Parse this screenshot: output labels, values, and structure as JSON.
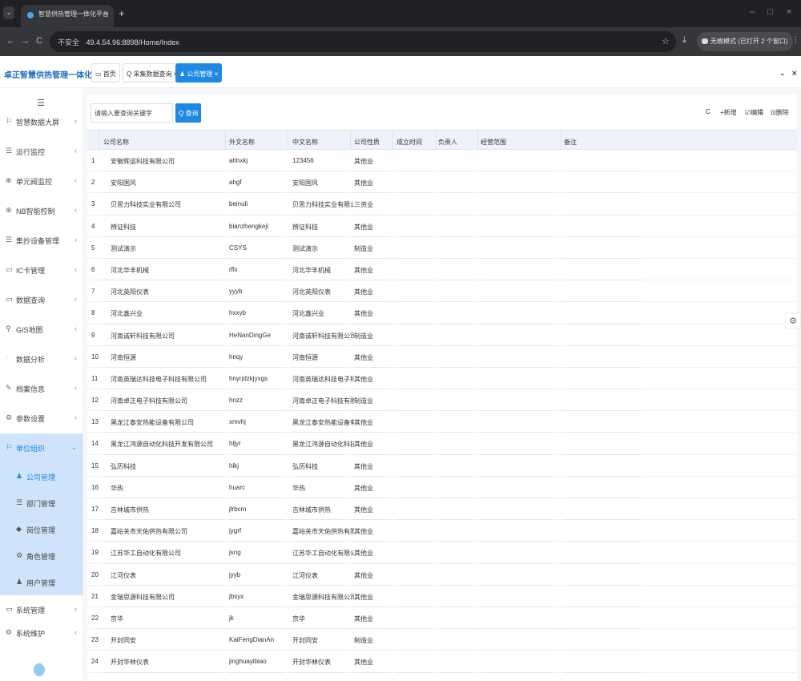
{
  "browser": {
    "tab_title": "智慧供热管理一体化平台",
    "tab_close": "×",
    "new_tab": "+",
    "min": "–",
    "restore": "□",
    "close": "×",
    "back": "←",
    "forward": "→",
    "reload": "C",
    "insecure": "不安全",
    "url": "49.4.54.96:8898/Home/Index",
    "star": "☆",
    "download": "⤓",
    "incognito_text": "无痕模式 (已打开 2 个窗口)",
    "menu": "⋮"
  },
  "app": {
    "brand": "卓正智慧供热管理一体化平台",
    "tabs": [
      {
        "icon": "▭",
        "label": "首页"
      },
      {
        "icon": "Q",
        "label": "采集数据查询",
        "close": "×"
      },
      {
        "icon": "♟",
        "label": "公司管理",
        "close": "×"
      }
    ],
    "header_right_down": "⌄",
    "header_right_x": "⨯"
  },
  "sidebar": {
    "collapse_icon": "☰",
    "items": [
      {
        "icon": "⚐",
        "label": "智慧数据大屏",
        "arrow": "‹"
      },
      {
        "icon": "☰",
        "label": "运行监控",
        "arrow": "‹"
      },
      {
        "icon": "⊕",
        "label": "单元阀监控",
        "arrow": "‹"
      },
      {
        "icon": "⊕",
        "label": "NB智能控制",
        "arrow": "‹"
      },
      {
        "icon": "☰",
        "label": "集抄设备管理",
        "arrow": "‹"
      },
      {
        "icon": "▭",
        "label": "IC卡管理",
        "arrow": "‹"
      },
      {
        "icon": "▭",
        "label": "数据查询",
        "arrow": "‹"
      },
      {
        "icon": "⚲",
        "label": "GIS地图",
        "arrow": "‹"
      },
      {
        "icon": "⫶",
        "label": "数据分析",
        "arrow": "‹"
      },
      {
        "icon": "✎",
        "label": "档案信息",
        "arrow": "‹"
      },
      {
        "icon": "⚙",
        "label": "参数设置",
        "arrow": "‹"
      },
      {
        "icon": "⚐",
        "label": "单位组织",
        "arrow": "⌄"
      }
    ],
    "subitems": [
      {
        "icon": "♟",
        "label": "公司管理"
      },
      {
        "icon": "☰",
        "label": "部门管理"
      },
      {
        "icon": "◆",
        "label": "岗位管理"
      },
      {
        "icon": "⚙",
        "label": "角色管理"
      },
      {
        "icon": "♟",
        "label": "用户管理"
      }
    ],
    "bottom_items": [
      {
        "icon": "▭",
        "label": "系统管理",
        "arrow": "‹"
      },
      {
        "icon": "⚙",
        "label": "系统维护",
        "arrow": "‹"
      }
    ]
  },
  "toolbar": {
    "search_placeholder": "请输入要查询关键字",
    "search_button": "查询",
    "search_icon": "Q",
    "refresh": "C",
    "add": "+新增",
    "edit": "☑编辑",
    "delete": "⊡删除"
  },
  "table": {
    "headers": [
      "公司名称",
      "外文名称",
      "中文名称",
      "公司性质",
      "成立时间",
      "负责人",
      "经营范围",
      "备注"
    ],
    "rows": [
      {
        "n": "1",
        "name": "安徽辉运科技有限公司",
        "en": "ahhxkj",
        "cn": "123456",
        "type": "其他业"
      },
      {
        "n": "2",
        "name": "安阳国风",
        "en": "ahgf",
        "cn": "安阳国风",
        "type": "其他业"
      },
      {
        "n": "3",
        "name": "贝思力科技实业有限公司",
        "en": "beinuli",
        "cn": "贝思力科技实业有限公司",
        "type": "三资业"
      },
      {
        "n": "4",
        "name": "辨证科技",
        "en": "bianzhengkeji",
        "cn": "辨证科技",
        "type": "其他业"
      },
      {
        "n": "5",
        "name": "测试演示",
        "en": "CSYS",
        "cn": "测试演示",
        "type": "制造业"
      },
      {
        "n": "6",
        "name": "河北华丰机械",
        "en": "rflx",
        "cn": "河北华丰机械",
        "type": "其他业"
      },
      {
        "n": "7",
        "name": "河北英阳仪表",
        "en": "yyyb",
        "cn": "河北英阳仪表",
        "type": "其他业"
      },
      {
        "n": "8",
        "name": "河北鑫兴业",
        "en": "hxxyb",
        "cn": "河北鑫兴业",
        "type": "其他业"
      },
      {
        "n": "9",
        "name": "河南诚轩科技有限公司",
        "en": "HeNanDingGe",
        "cn": "河南诚轩科技有限公司",
        "type": "制造业"
      },
      {
        "n": "10",
        "name": "河南恒源",
        "en": "hnqy",
        "cn": "河南恒源",
        "type": "其他业"
      },
      {
        "n": "11",
        "name": "河南英瑞达科技电子科技有限公司",
        "en": "hnyrjdzkjyxgs",
        "cn": "河南英瑞达科技电子科技有...",
        "type": "其他业"
      },
      {
        "n": "12",
        "name": "河南卓正电子科技有限公司",
        "en": "hnzz",
        "cn": "河南卓正电子科技有限公司",
        "type": "制造业"
      },
      {
        "n": "13",
        "name": "黑龙江泰安热能设备有限公司",
        "en": "xmvhj",
        "cn": "黑龙江泰安热能设备有限公司",
        "type": "其他业"
      },
      {
        "n": "14",
        "name": "黑龙江鸿源自动化科技开发有限公司",
        "en": "hljyr",
        "cn": "黑龙江鸿源自动化科技开...",
        "type": "其他业"
      },
      {
        "n": "15",
        "name": "弘历科技",
        "en": "hlkj",
        "cn": "弘历科技",
        "type": "其他业"
      },
      {
        "n": "16",
        "name": "华热",
        "en": "huarc",
        "cn": "华热",
        "type": "其他业"
      },
      {
        "n": "17",
        "name": "吉林城市供热",
        "en": "jlrbcm",
        "cn": "吉林城市供热",
        "type": "其他业"
      },
      {
        "n": "18",
        "name": "嘉峪关市天佑供热有限公司",
        "en": "jygrf",
        "cn": "嘉峪关市天佑供热有限公...",
        "type": "其他业"
      },
      {
        "n": "19",
        "name": "江苏华工自动化有限公司",
        "en": "jsng",
        "cn": "江苏华工自动化有限公司",
        "type": "其他业"
      },
      {
        "n": "20",
        "name": "江河仪表",
        "en": "jyyb",
        "cn": "江河仪表",
        "type": "其他业"
      },
      {
        "n": "21",
        "name": "金瑞思源科技有限公司",
        "en": "jbsyx",
        "cn": "金瑞思源科技有限公司",
        "type": "其他业"
      },
      {
        "n": "22",
        "name": "京华",
        "en": "jk",
        "cn": "京华",
        "type": "其他业"
      },
      {
        "n": "23",
        "name": "开封同安",
        "en": "KaiFengDianAn",
        "cn": "开封同安",
        "type": "制造业"
      },
      {
        "n": "24",
        "name": "开封华林仪表",
        "en": "jinghuayibiao",
        "cn": "开封华林仪表",
        "type": "其他业"
      }
    ]
  },
  "float_gear": "⚙"
}
